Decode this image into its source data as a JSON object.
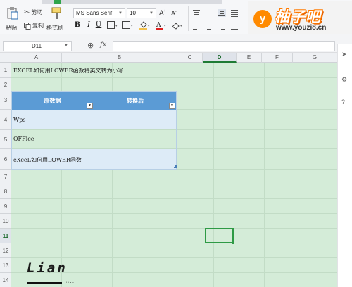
{
  "ribbon": {
    "cut_label": "剪切",
    "paste_label": "粘贴",
    "copy_label": "复制",
    "format_painter_label": "格式刷",
    "font_name": "MS Sans Serif",
    "font_size": "10",
    "bold": "B",
    "italic": "I",
    "underline": "U"
  },
  "watermark": {
    "logo": "y",
    "title": "柚子吧",
    "url": "www.youzi8.cn"
  },
  "formula_bar": {
    "cell_ref": "D11",
    "fx": "fx",
    "content": ""
  },
  "sheet": {
    "columns": [
      "A",
      "B",
      "C",
      "D",
      "E",
      "F",
      "G"
    ],
    "selected_column": "D",
    "rows": [
      "1",
      "2",
      "3",
      "4",
      "5",
      "6",
      "7",
      "8",
      "9",
      "10",
      "11",
      "12",
      "13",
      "14"
    ],
    "selected_row": "11",
    "a1_title": "EXCEL如何用LOWER函数将英文转为小写",
    "table_headers": [
      "原数据",
      "转换后"
    ],
    "table_rows": [
      "Wps",
      "OFFice",
      "eXceL如何用LOWER函数"
    ]
  },
  "signature": {
    "name": "Lian",
    "small": "Lian"
  },
  "colors": {
    "sheet_bg": "#d4ecd8",
    "table_header": "#5b9bd5",
    "table_row": "#ddebf7",
    "selection": "#2e9a45",
    "watermark_orange": "#ff7a00"
  }
}
